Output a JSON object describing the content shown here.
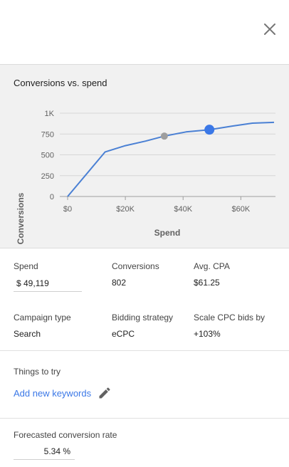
{
  "header": {
    "close_icon": "close-icon"
  },
  "chart": {
    "title": "Conversions vs. spend",
    "xlabel": "Spend",
    "ylabel": "Conversions"
  },
  "chart_data": {
    "type": "line",
    "title": "Conversions vs. spend",
    "xlabel": "Spend",
    "ylabel": "Conversions",
    "xlim": [
      0,
      72000
    ],
    "ylim": [
      0,
      1000
    ],
    "x_tick_labels": [
      "$0",
      "$20K",
      "$40K",
      "$60K"
    ],
    "x_tick_values": [
      0,
      20000,
      40000,
      60000
    ],
    "y_tick_labels": [
      "0",
      "250",
      "500",
      "750",
      "1K"
    ],
    "y_tick_values": [
      0,
      250,
      500,
      750,
      1000
    ],
    "grid": "horizontal",
    "series": [
      {
        "x": [
          0,
          13000,
          20000,
          27000,
          33500,
          41000,
          49119,
          57000,
          64000,
          71500
        ],
        "y": [
          0,
          535,
          610,
          665,
          725,
          775,
          802,
          845,
          880,
          890
        ],
        "color": "#4a80d4"
      }
    ],
    "markers": [
      {
        "x": 33500,
        "y": 725,
        "color": "#9e9e9e"
      },
      {
        "x": 49119,
        "y": 802,
        "color": "#3b78e7"
      }
    ]
  },
  "metrics": {
    "spend": {
      "label": "Spend",
      "value": "$ 49,119"
    },
    "conversions": {
      "label": "Conversions",
      "value": "802"
    },
    "avg_cpa": {
      "label": "Avg. CPA",
      "value": "$61.25"
    },
    "campaign_type": {
      "label": "Campaign type",
      "value": "Search"
    },
    "bidding_strategy": {
      "label": "Bidding strategy",
      "value": "eCPC"
    },
    "scale_cpc": {
      "label": "Scale CPC bids by",
      "value": "+103%"
    }
  },
  "things_to_try": {
    "title": "Things to try",
    "link": "Add new keywords",
    "edit_icon": "pencil-icon"
  },
  "forecast": {
    "label": "Forecasted conversion rate",
    "value": "5.34 %"
  },
  "colors": {
    "accent": "#3b78e7",
    "line": "#4a80d4",
    "marker_current": "#3b78e7",
    "marker_reference": "#9e9e9e",
    "panel_bg": "#f1f1f1"
  }
}
